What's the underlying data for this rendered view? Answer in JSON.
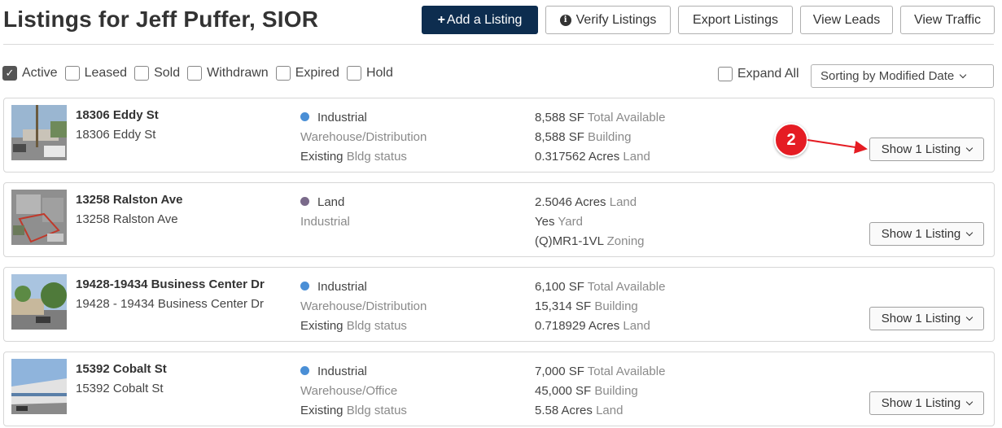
{
  "page": {
    "title": "Listings for Jeff Puffer, SIOR"
  },
  "header_buttons": {
    "add_listing": "Add a Listing",
    "add_plus": "+",
    "verify": "Verify Listings",
    "export": "Export Listings",
    "leads": "View Leads",
    "traffic": "View Traffic"
  },
  "filters": [
    {
      "label": "Active",
      "checked": true
    },
    {
      "label": "Leased",
      "checked": false
    },
    {
      "label": "Sold",
      "checked": false
    },
    {
      "label": "Withdrawn",
      "checked": false
    },
    {
      "label": "Expired",
      "checked": false
    },
    {
      "label": "Hold",
      "checked": false
    }
  ],
  "expand_all": {
    "label": "Expand All",
    "checked": false
  },
  "sort": {
    "label": "Sorting by Modified Date"
  },
  "colors": {
    "primary": "#0d2d4f",
    "industrial_dot": "#4a8fd6",
    "land_dot": "#7a6a8a",
    "annotation_red": "#e51c23"
  },
  "annotation": {
    "badge": "2"
  },
  "listings": [
    {
      "name": "18306 Eddy St",
      "address": "18306 Eddy St",
      "type": "Industrial",
      "type_color": "#4a8fd6",
      "subtype": "Warehouse/Distribution",
      "status_value": "Existing",
      "status_label": "Bldg status",
      "m1_value": "8,588 SF",
      "m1_label": "Total Available",
      "m2_value": "8,588 SF",
      "m2_label": "Building",
      "m3_value": "0.317562 Acres",
      "m3_label": "Land",
      "show_label": "Show 1 Listing"
    },
    {
      "name": "13258 Ralston Ave",
      "address": "13258 Ralston Ave",
      "type": "Land",
      "type_color": "#7a6a8a",
      "subtype": "Industrial",
      "status_value": "",
      "status_label": "",
      "m1_value": "2.5046 Acres",
      "m1_label": "Land",
      "m2_value": "Yes",
      "m2_label": "Yard",
      "m3_value": "(Q)MR1-1VL",
      "m3_label": "Zoning",
      "show_label": "Show 1 Listing"
    },
    {
      "name": "19428-19434 Business Center Dr",
      "address": "19428 - 19434 Business Center Dr",
      "type": "Industrial",
      "type_color": "#4a8fd6",
      "subtype": "Warehouse/Distribution",
      "status_value": "Existing",
      "status_label": "Bldg status",
      "m1_value": "6,100 SF",
      "m1_label": "Total Available",
      "m2_value": "15,314 SF",
      "m2_label": "Building",
      "m3_value": "0.718929 Acres",
      "m3_label": "Land",
      "show_label": "Show 1 Listing"
    },
    {
      "name": "15392 Cobalt St",
      "address": "15392 Cobalt St",
      "type": "Industrial",
      "type_color": "#4a8fd6",
      "subtype": "Warehouse/Office",
      "status_value": "Existing",
      "status_label": "Bldg status",
      "m1_value": "7,000 SF",
      "m1_label": "Total Available",
      "m2_value": "45,000 SF",
      "m2_label": "Building",
      "m3_value": "5.58 Acres",
      "m3_label": "Land",
      "show_label": "Show 1 Listing"
    }
  ]
}
